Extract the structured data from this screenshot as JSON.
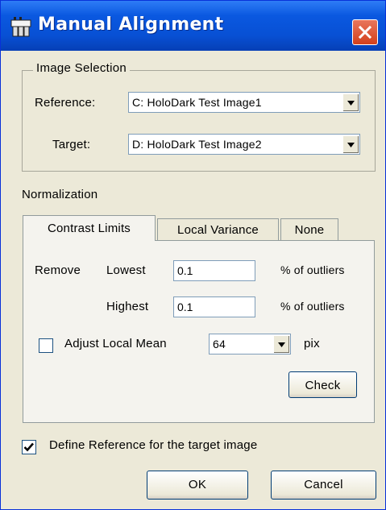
{
  "window": {
    "title": "Manual Alignment"
  },
  "image_selection": {
    "group_title": "Image Selection",
    "reference_label": "Reference:",
    "reference_value": "C: HoloDark Test Image1",
    "target_label": "Target:",
    "target_value": "D: HoloDark Test Image2"
  },
  "normalization": {
    "label": "Normalization",
    "tabs": [
      "Contrast Limits",
      "Local Variance",
      "None"
    ],
    "active_tab": "Contrast Limits",
    "remove_label": "Remove",
    "lowest_label": "Lowest",
    "lowest_value": "0.1",
    "highest_label": "Highest",
    "highest_value": "0.1",
    "outliers_unit": "% of outliers",
    "adjust_label": "Adjust Local Mean",
    "adjust_checked": false,
    "adjust_value": "64",
    "pix_label": "pix",
    "check_button": "Check"
  },
  "define_reference": {
    "label": "Define Reference for the target image",
    "checked": true
  },
  "buttons": {
    "ok": "OK",
    "cancel": "Cancel"
  },
  "colors": {
    "titlebar": "#0a58e0",
    "dialog_bg": "#ece9d8",
    "close_button": "#d4401c"
  }
}
